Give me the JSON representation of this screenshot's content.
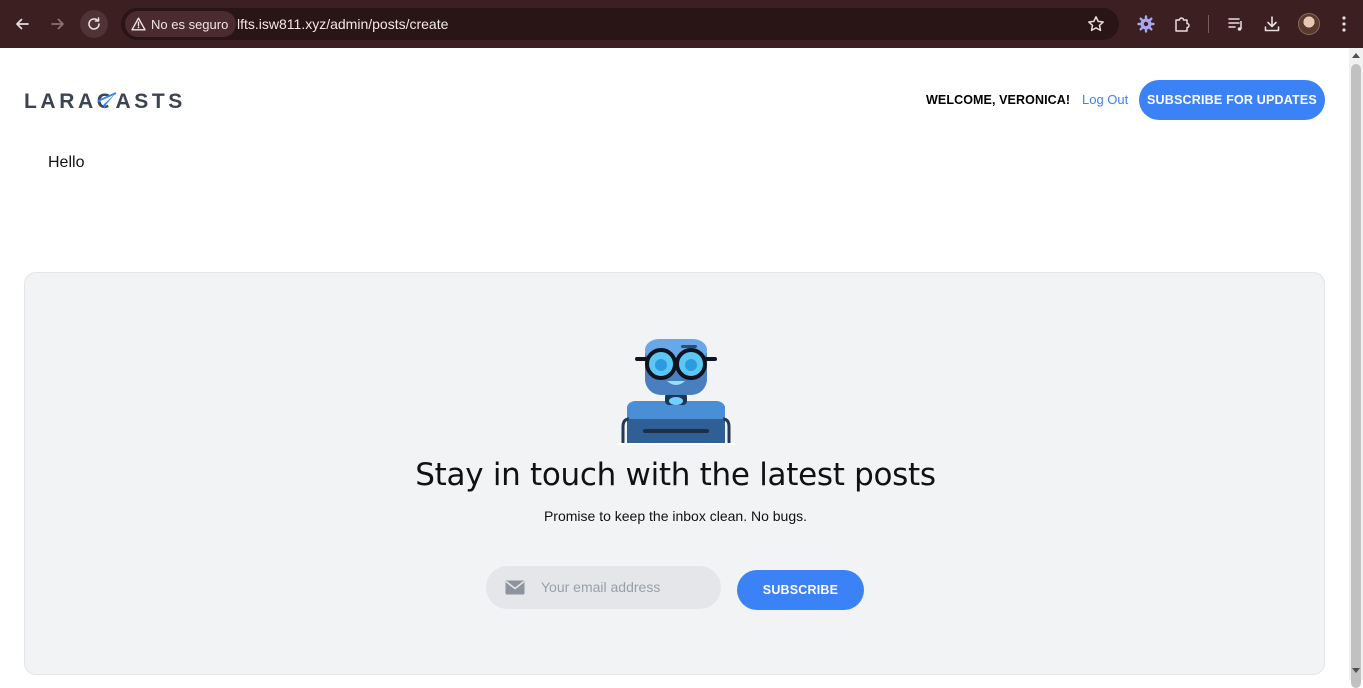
{
  "browser": {
    "security_label": "No es seguro",
    "url": "lfts.isw811.xyz/admin/posts/create"
  },
  "header": {
    "logo_text": "LARACASTS",
    "welcome": "WELCOME, VERONICA!",
    "logout_label": "Log Out",
    "subscribe_updates_label": "SUBSCRIBE FOR UPDATES"
  },
  "main": {
    "content": "Hello"
  },
  "newsletter": {
    "title": "Stay in touch with the latest posts",
    "subtitle": "Promise to keep the inbox clean. No bugs.",
    "email_placeholder": "Your email address",
    "subscribe_label": "SUBSCRIBE"
  },
  "colors": {
    "toolbar": "#3c1f21",
    "accent": "#3b82f6",
    "panel": "#f2f3f5"
  }
}
